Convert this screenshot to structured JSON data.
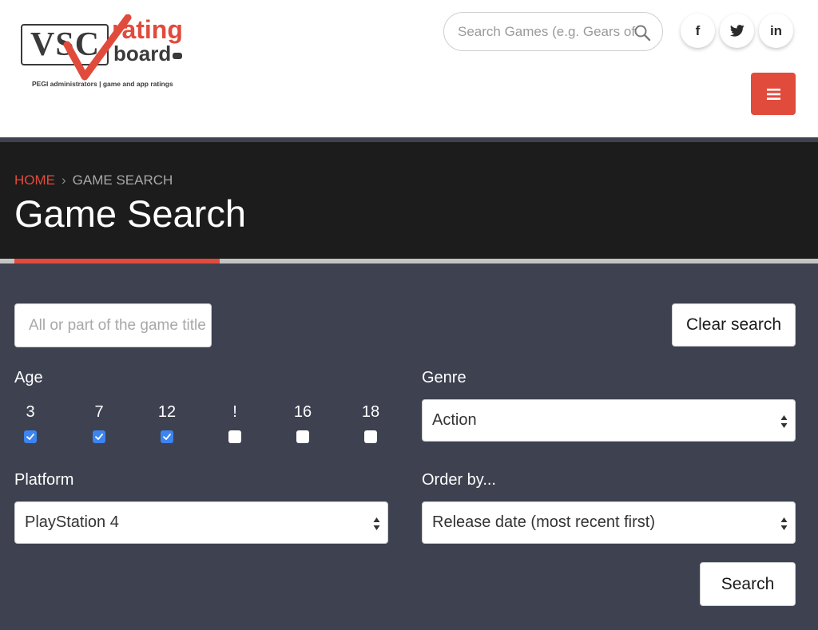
{
  "logo": {
    "vsc": "VSC",
    "rating": "rating",
    "board": "board",
    "tagline": "PEGI administrators  |  game and app ratings"
  },
  "header_search": {
    "placeholder": "Search Games (e.g. Gears of War)"
  },
  "social": {
    "facebook": "f",
    "twitter": "twitter",
    "linkedin": "in"
  },
  "breadcrumb": {
    "home": "HOME",
    "separator": "›",
    "current": "GAME SEARCH"
  },
  "page_title": "Game Search",
  "form": {
    "title_placeholder": "All or part of the game title",
    "clear_label": "Clear search",
    "search_label": "Search",
    "age": {
      "label": "Age",
      "options": [
        {
          "label": "3",
          "checked": true
        },
        {
          "label": "7",
          "checked": true
        },
        {
          "label": "12",
          "checked": true
        },
        {
          "label": "!",
          "checked": false
        },
        {
          "label": "16",
          "checked": false
        },
        {
          "label": "18",
          "checked": false
        }
      ]
    },
    "genre": {
      "label": "Genre",
      "value": "Action"
    },
    "platform": {
      "label": "Platform",
      "value": "PlayStation 4"
    },
    "order": {
      "label": "Order by...",
      "value": "Release date (most recent first)"
    }
  },
  "colors": {
    "accent": "#e14b3c",
    "checkbox": "#3c84f0",
    "panel": "#3e4150",
    "band": "#1c1c1c"
  }
}
